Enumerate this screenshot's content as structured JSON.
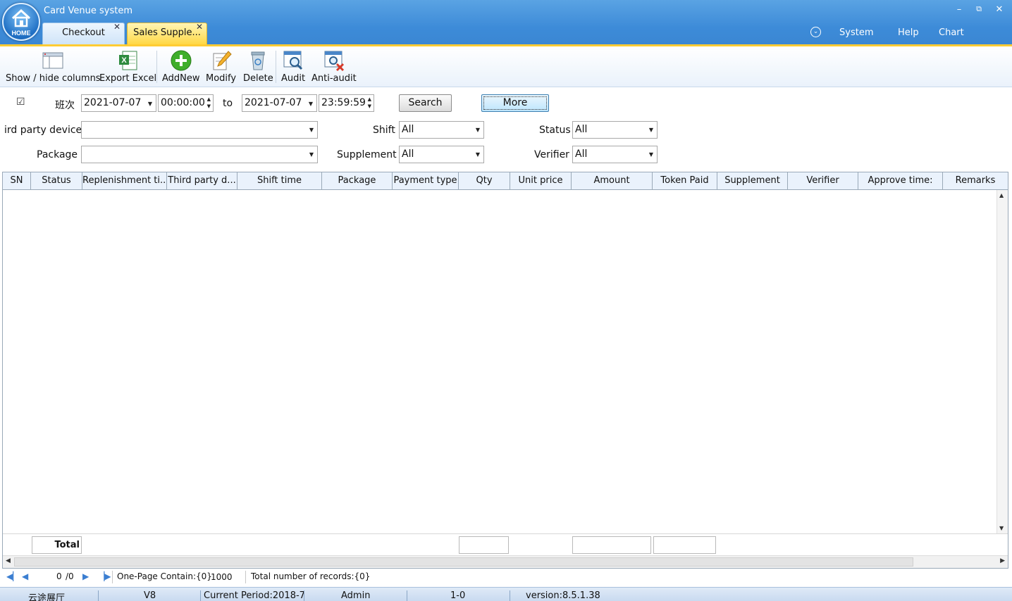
{
  "app": {
    "title": "Card Venue system",
    "home_label": "HOME"
  },
  "window_controls": {
    "minimize": "–",
    "restore": "⧉",
    "close": "✕"
  },
  "tabs": [
    {
      "label": "Checkout",
      "close": "✕"
    },
    {
      "label": "Sales Supple...",
      "close": "✕"
    }
  ],
  "menu": {
    "system": "System",
    "help": "Help",
    "chart": "Chart"
  },
  "toolbar": {
    "show_hide": "Show / hide columns",
    "export_excel": "Export Excel",
    "add_new": "AddNew",
    "modify": "Modify",
    "delete": "Delete",
    "audit": "Audit",
    "anti_audit": "Anti-audit"
  },
  "filters": {
    "shift_checkbox_label": "班次",
    "checkbox_mark": "☑",
    "start_date": "2021-07-07",
    "start_time": "00:00:00",
    "to_label": "to",
    "end_date": "2021-07-07",
    "end_time": "23:59:59",
    "search_label": "Search",
    "more_label": "More",
    "third_party_label": "ird party device",
    "third_party_value": "",
    "shift_label": "Shift",
    "shift_value": "All",
    "status_label": "Status",
    "status_value": "All",
    "package_label": "Package",
    "package_value": "",
    "supplement_label": "Supplement",
    "supplement_value": "All",
    "verifier_label": "Verifier",
    "verifier_value": "All"
  },
  "grid": {
    "columns": [
      "SN",
      "Status",
      "Replenishment ti...",
      "Third party d...",
      "Shift time",
      "Package",
      "Payment type",
      "Qty",
      "Unit price",
      "Amount",
      "Token Paid",
      "Supplement",
      "Verifier",
      "Approve time:",
      "Remarks"
    ],
    "rows": [],
    "total_label": "Total"
  },
  "pager": {
    "page": "0",
    "of_pages": "/0",
    "one_page_contain": "One-Page Contain:{0}",
    "page_size": "1000",
    "total_records": "Total number of records:{0}"
  },
  "status_bar": {
    "venue": "云途展厅",
    "version_short": "V8",
    "period": "Current Period:2018-7",
    "user": "Admin",
    "code": "1-0",
    "version": "version:8.5.1.38"
  }
}
